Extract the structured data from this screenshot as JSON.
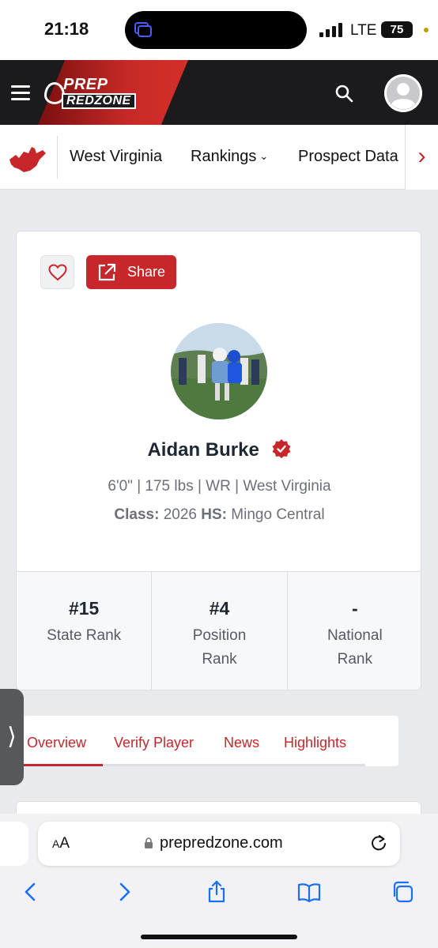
{
  "status_bar": {
    "time": "21:18",
    "network": "LTE",
    "battery": "75"
  },
  "site": {
    "logo_line1": "PREP",
    "logo_line2": "REDZONE"
  },
  "subnav": {
    "items": [
      "West Virginia",
      "Rankings",
      "Prospect Data"
    ]
  },
  "profile": {
    "favorite_label": "",
    "share_label": "Share",
    "name": "Aidan Burke",
    "meta": "6'0\" | 175 lbs | WR | West Virginia",
    "class_label": "Class:",
    "class_value": "2026",
    "hs_label": "HS:",
    "hs_value": "Mingo Central",
    "ranks": [
      {
        "value": "#15",
        "label": "State Rank"
      },
      {
        "value": "#4",
        "label": "Position Rank"
      },
      {
        "value": "-",
        "label": "National Rank"
      }
    ]
  },
  "tabs": {
    "items": [
      "Overview",
      "Verify Player",
      "News",
      "Highlights"
    ],
    "active": "Overview"
  },
  "browser": {
    "text_size_label": "AA",
    "url": "prepredzone.com"
  },
  "colors": {
    "brand_red": "#c7262b",
    "nav_dark": "#1b1b1d",
    "ios_blue": "#1a6ff4"
  }
}
